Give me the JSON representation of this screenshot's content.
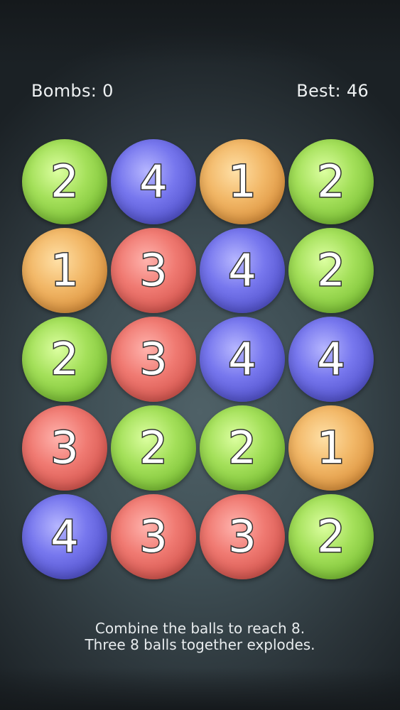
{
  "header": {
    "bombs_label": "Bombs: 0",
    "best_label": "Best: 46"
  },
  "board": {
    "rows": [
      [
        2,
        4,
        1,
        2
      ],
      [
        1,
        3,
        4,
        2
      ],
      [
        2,
        3,
        4,
        4
      ],
      [
        3,
        2,
        2,
        1
      ],
      [
        4,
        3,
        3,
        2
      ]
    ],
    "colors": {
      "1": "#eeb163",
      "2": "#9fdc55",
      "3": "#ec736c",
      "4": "#6e6ee6"
    }
  },
  "instructions": {
    "line1": "Combine the balls to reach 8.",
    "line2": "Three 8 balls together explodes."
  }
}
